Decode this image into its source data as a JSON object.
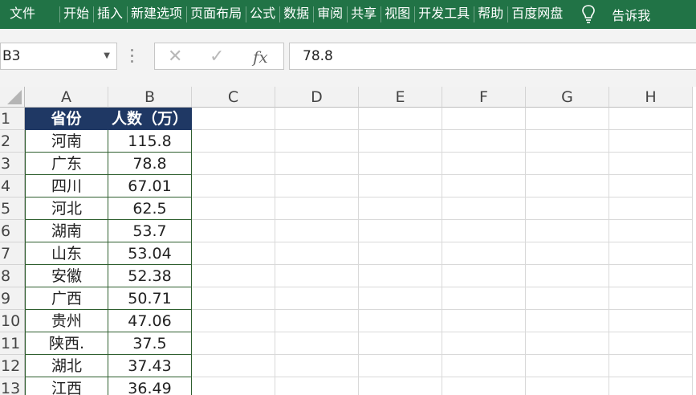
{
  "ribbon": {
    "tabs": [
      "文件",
      "开始",
      "插入",
      "新建选项",
      "页面布局",
      "公式",
      "数据",
      "审阅",
      "共享",
      "视图",
      "开发工具",
      "帮助",
      "百度网盘"
    ],
    "tell_me": "告诉我",
    "bulb_icon": "lightbulb-icon"
  },
  "formula_bar": {
    "name_box": "B3",
    "cancel_icon": "✕",
    "enter_icon": "✓",
    "fx_label": "fx",
    "value": "78.8"
  },
  "grid": {
    "columns": [
      "A",
      "B",
      "C",
      "D",
      "E",
      "F",
      "G",
      "H"
    ],
    "row_numbers": [
      "1",
      "2",
      "3",
      "4",
      "5",
      "6",
      "7",
      "8",
      "9",
      "10",
      "11",
      "12",
      "13"
    ],
    "header": [
      "省份",
      "人数（万）"
    ],
    "rows": [
      [
        "河南",
        "115.8"
      ],
      [
        "广东",
        "78.8"
      ],
      [
        "四川",
        "67.01"
      ],
      [
        "河北",
        "62.5"
      ],
      [
        "湖南",
        "53.7"
      ],
      [
        "山东",
        "53.04"
      ],
      [
        "安徽",
        "52.38"
      ],
      [
        "广西",
        "50.71"
      ],
      [
        "贵州",
        "47.06"
      ],
      [
        "陕西.",
        "37.5"
      ],
      [
        "湖北",
        "37.43"
      ],
      [
        "江西",
        "36.49"
      ]
    ]
  },
  "colors": {
    "ribbon_green": "#217346",
    "header_fill": "#1f3864",
    "table_border": "#2f5f2f"
  }
}
